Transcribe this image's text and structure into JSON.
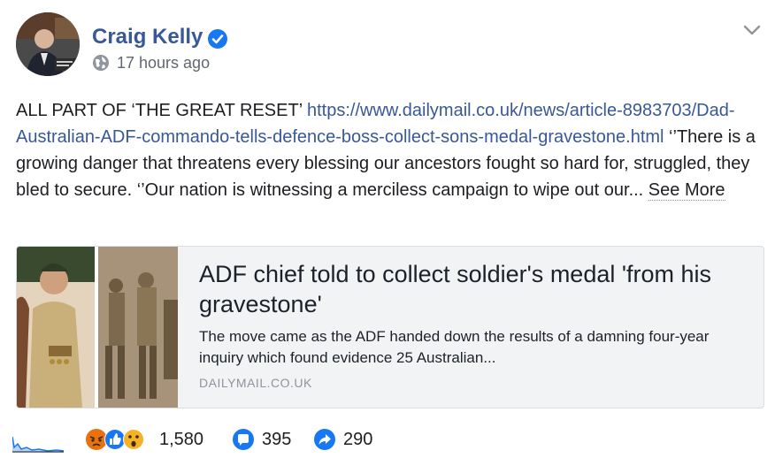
{
  "post": {
    "author": "Craig Kelly",
    "timestamp": "17 hours ago",
    "text_prefix": "ALL PART OF ‘THE GREAT RESET’ ",
    "link": "https://www.dailymail.co.uk/news/article-8983703/Dad-Australian-ADF-commando-tells-defence-boss-collect-sons-medal-gravestone.html",
    "text_body": " ‘’There is a growing danger that threatens every blessing our ancestors fought so hard for, struggled, they bled to secure. ‘’Our nation is witnessing a merciless campaign to wipe out our... ",
    "see_more": "See More"
  },
  "card": {
    "title": "ADF chief told to collect soldier's medal 'from his gravestone'",
    "description": "The move came as the ADF handed down the results of a damning four-year inquiry which found evidence 25 Australian...",
    "domain": "DAILYMAIL.CO.UK"
  },
  "engagement": {
    "reactions": "1,580",
    "comments": "395",
    "shares": "290"
  },
  "icons": {
    "verified": "verified-badge-icon",
    "privacy": "globe-icon",
    "menu": "chevron-down-icon",
    "comment": "comment-icon",
    "share": "share-icon",
    "sparkline": "sparkline-chart-icon"
  },
  "colors": {
    "link": "#385898",
    "accent": "#1877f2",
    "angry": "#e9710f",
    "wow": "#f7b125"
  }
}
